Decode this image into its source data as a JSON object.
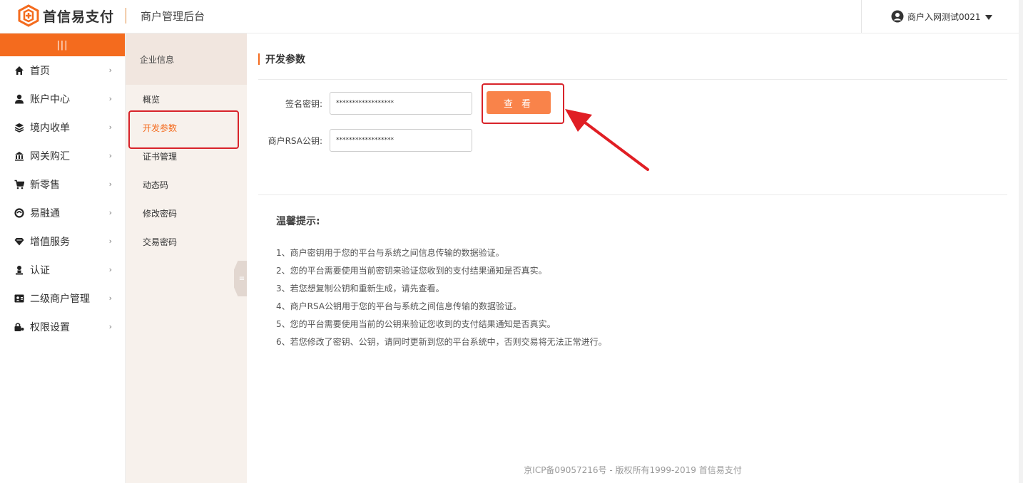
{
  "header": {
    "brand": "首信易支付",
    "title": "商户管理后台",
    "user": "商户入网测试0021",
    "brand_color": "#f46b1e"
  },
  "sidebar": {
    "collapse_label": "|||",
    "items": [
      {
        "label": "首页",
        "icon": "home-icon"
      },
      {
        "label": "账户中心",
        "icon": "user-icon"
      },
      {
        "label": "境内收单",
        "icon": "layers-icon"
      },
      {
        "label": "网关购汇",
        "icon": "bank-icon"
      },
      {
        "label": "新零售",
        "icon": "cart-icon"
      },
      {
        "label": "易融通",
        "icon": "loop-icon"
      },
      {
        "label": "增值服务",
        "icon": "diamond-icon"
      },
      {
        "label": "认证",
        "icon": "person-stand-icon"
      },
      {
        "label": "二级商户管理",
        "icon": "id-card-icon"
      },
      {
        "label": "权限设置",
        "icon": "lock-key-icon"
      }
    ]
  },
  "subnav": {
    "heading": "企业信息",
    "items": [
      "概览",
      "开发参数",
      "证书管理",
      "动态码",
      "修改密码",
      "交易密码"
    ],
    "active_index": 1
  },
  "main": {
    "section_title": "开发参数",
    "sign_key_label": "签名密钥:",
    "sign_key_value": "******************",
    "rsa_key_label": "商户RSA公钥:",
    "rsa_key_value": "******************",
    "view_button": "查 看",
    "tips_title": "温馨提示:",
    "tips": [
      "1、商户密钥用于您的平台与系统之间信息传输的数据验证。",
      "2、您的平台需要使用当前密钥来验证您收到的支付结果通知是否真实。",
      "3、若您想复制公钥和重新生成，请先查看。",
      "4、商户RSA公钥用于您的平台与系统之间信息传输的数据验证。",
      "5、您的平台需要使用当前的公钥来验证您收到的支付结果通知是否真实。",
      "6、若您修改了密钥、公钥，请同时更新到您的平台系统中，否则交易将无法正常进行。"
    ],
    "footer": "京ICP备09057216号 - 版权所有1999-2019 首信易支付"
  },
  "annotation_color": "#d8232a"
}
